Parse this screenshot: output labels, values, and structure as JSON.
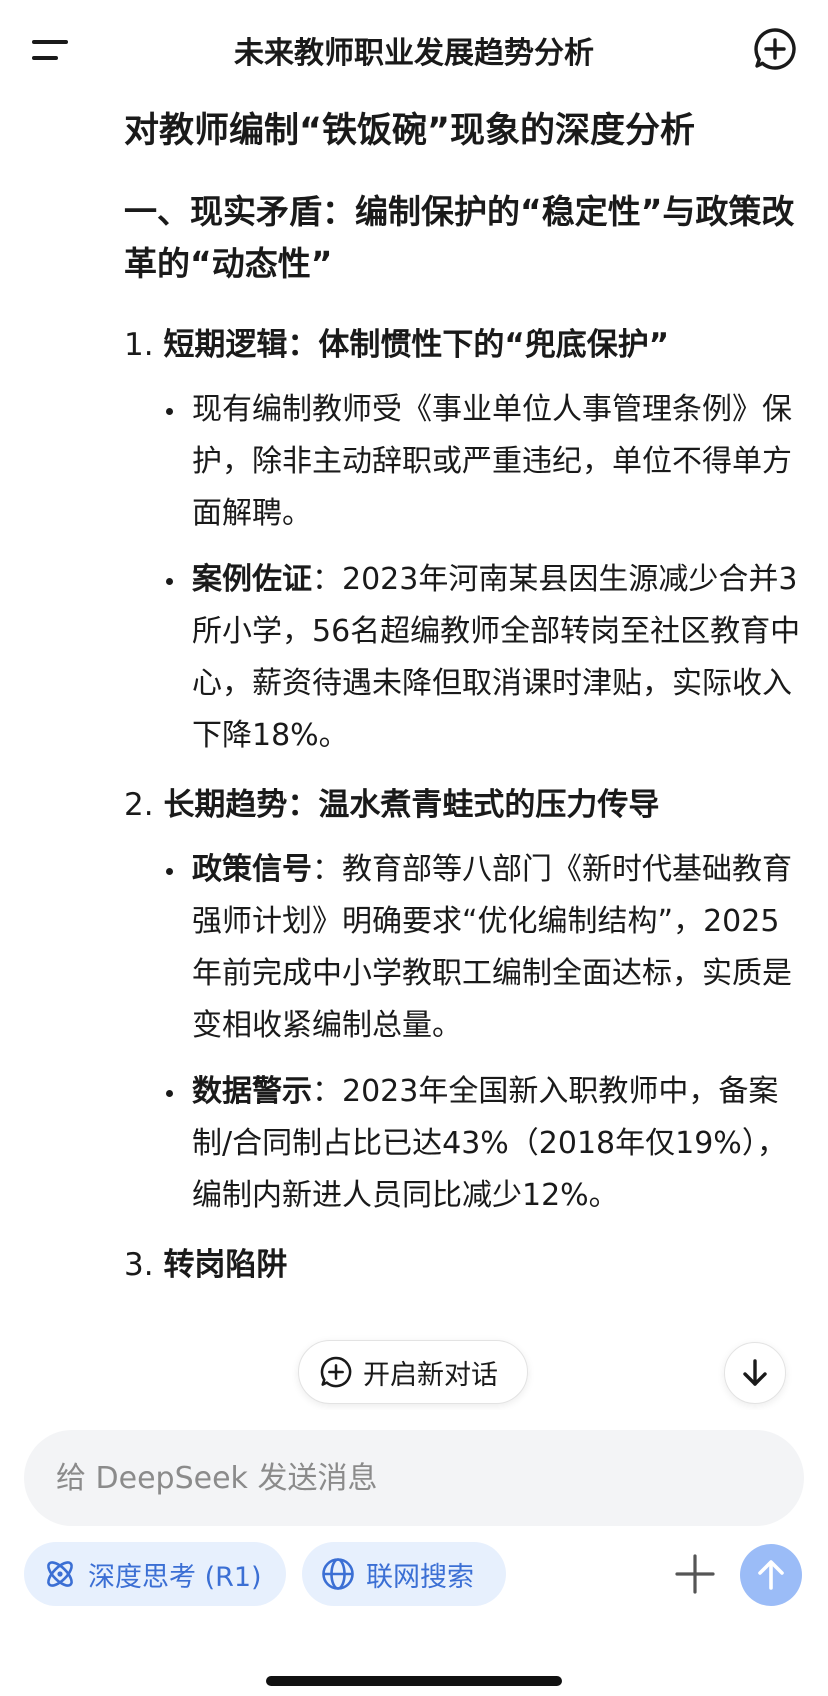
{
  "header": {
    "title": "未来教师职业发展趋势分析"
  },
  "article": {
    "heading": "对教师编制“铁饭碗”现象的深度分析",
    "section1_title": "一、现实矛盾：编制保护的“稳定性”与政策改革的“动态性”",
    "item1": {
      "num": "1.",
      "title": "短期逻辑：体制惯性下的“兜底保护”",
      "bullets": [
        {
          "bold": "",
          "text": "现有编制教师受《事业单位人事管理条例》保护，除非主动辞职或严重违纪，单位不得单方面解聘。"
        },
        {
          "bold": "案例佐证",
          "text": "：2023年河南某县因生源减少合并3所小学，56名超编教师全部转岗至社区教育中心，薪资待遇未降但取消课时津贴，实际收入下降18%。"
        }
      ]
    },
    "item2": {
      "num": "2.",
      "title": "长期趋势：温水煮青蛙式的压力传导",
      "bullets": [
        {
          "bold": "政策信号",
          "text": "：教育部等八部门《新时代基础教育强师计划》明确要求“优化编制结构”，2025年前完成中小学教职工编制全面达标，实质是变相收紧编制总量。"
        },
        {
          "bold": "数据警示",
          "text": "：2023年全国新入职教师中，备案制/合同制占比已达43%（2018年仅19%），编制内新进人员同比减少12%。"
        }
      ]
    },
    "item3": {
      "num": "3.",
      "title": "转岗陷阱"
    }
  },
  "floating": {
    "new_chat_label": "开启新对话"
  },
  "composer": {
    "placeholder": "给 DeepSeek 发送消息",
    "deep_think_label": "深度思考 (R1)",
    "web_search_label": "联网搜索"
  },
  "colors": {
    "accent": "#3b6fd4",
    "pill_bg": "#e7f0fd",
    "send_button": "#9bbcf7",
    "input_bg": "#f3f4f6"
  }
}
